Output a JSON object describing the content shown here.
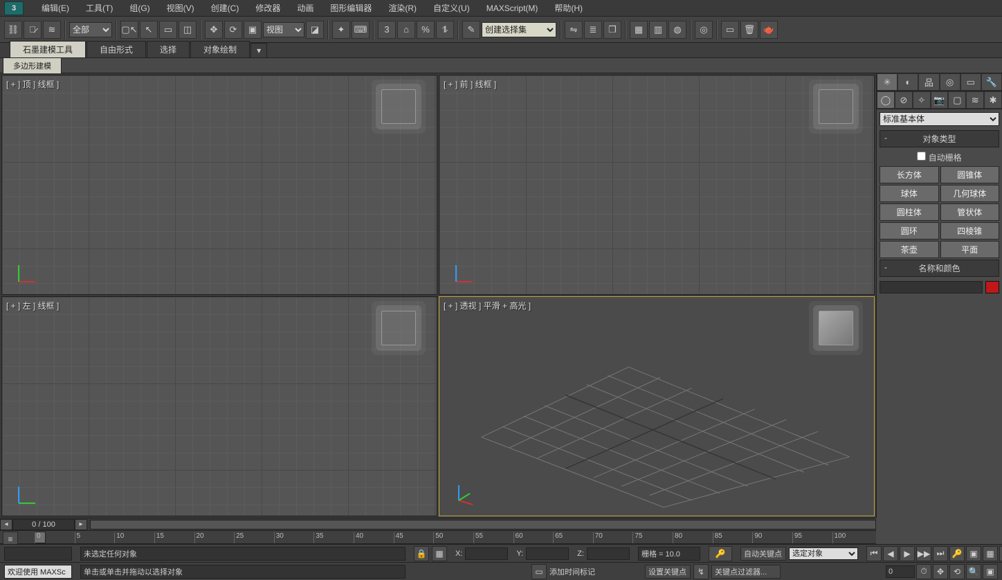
{
  "menu": [
    "编辑(E)",
    "工具(T)",
    "组(G)",
    "视图(V)",
    "创建(C)",
    "修改器",
    "动画",
    "图形编辑器",
    "渲染(R)",
    "自定义(U)",
    "MAXScript(M)",
    "帮助(H)"
  ],
  "toolbar": {
    "filter_select": "全部",
    "view_select": "视图",
    "selection_set": "创建选择集"
  },
  "ribbon": {
    "tabs": [
      "石墨建模工具",
      "自由形式",
      "选择",
      "对象绘制"
    ],
    "subtab": "多边形建模"
  },
  "viewports": {
    "top": "[ + ] 顶 ] 线框 ]",
    "front": "[ + ] 前 ] 线框 ]",
    "left": "[ + ] 左 ] 线框 ]",
    "persp": "[ + ] 透视 ] 平滑 + 高光 ]"
  },
  "cmd": {
    "category": "标准基本体",
    "roll_objtype": "对象类型",
    "autogrid": "自动栅格",
    "objects": [
      "长方体",
      "圆锥体",
      "球体",
      "几何球体",
      "圆柱体",
      "管状体",
      "圆环",
      "四棱锥",
      "茶壶",
      "平面"
    ],
    "roll_name": "名称和颜色",
    "name_value": ""
  },
  "track": {
    "frame": "0 / 100"
  },
  "timeline": {
    "ticks": [
      "0",
      "5",
      "10",
      "15",
      "20",
      "25",
      "30",
      "35",
      "40",
      "45",
      "50",
      "55",
      "60",
      "65",
      "70",
      "75",
      "80",
      "85",
      "90",
      "95",
      "100"
    ]
  },
  "status": {
    "no_sel": "未选定任何对象",
    "hint": "单击或单击并拖动以选择对象",
    "welcome": "欢迎使用  MAXSc",
    "x": "X:",
    "y": "Y:",
    "z": "Z:",
    "grid": "栅格 = 10.0",
    "addtime": "添加时间标记",
    "autokey": "自动关键点",
    "setkey": "设置关键点",
    "keyfilter": "关键点过滤器...",
    "sel_combo": "选定对象"
  }
}
